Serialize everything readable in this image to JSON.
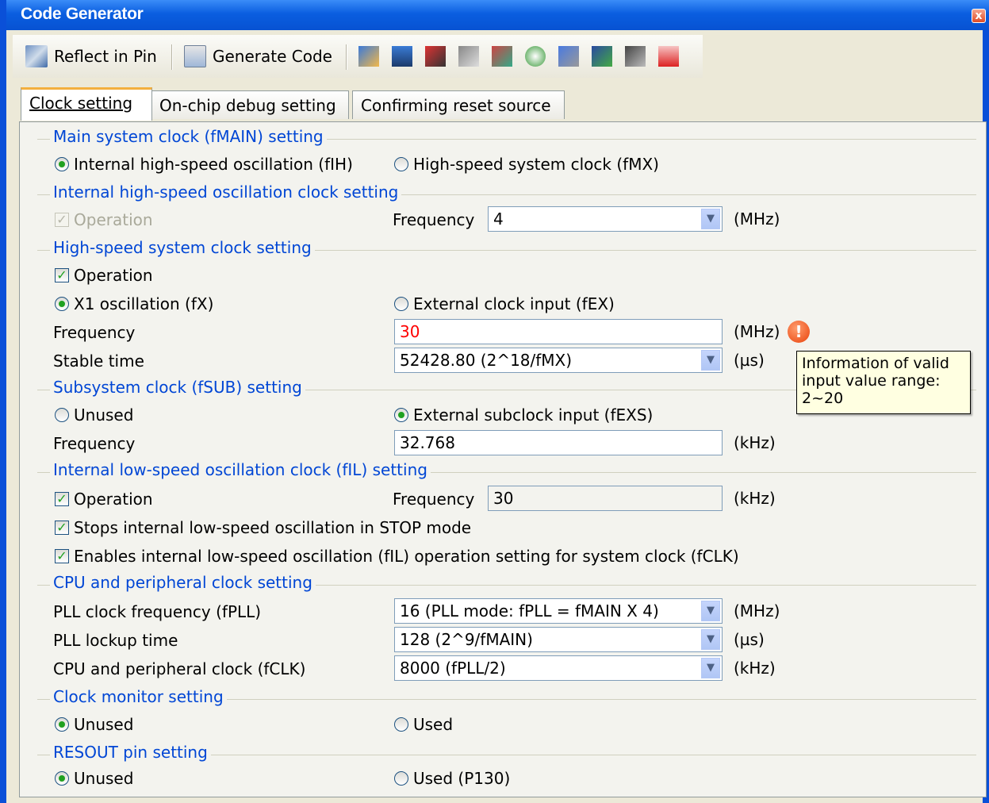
{
  "window": {
    "title": "Code Generator",
    "close": "x"
  },
  "toolbar": {
    "reflect_label": "Reflect in Pin",
    "generate_label": "Generate Code"
  },
  "tabs": [
    {
      "label": "Clock setting"
    },
    {
      "label": "On-chip debug setting"
    },
    {
      "label": "Confirming reset source"
    }
  ],
  "main_clock": {
    "title": "Main system clock (fMAIN) setting",
    "opt_internal": "Internal high-speed oscillation (fIH)",
    "opt_highspeed": "High-speed system clock (fMX)"
  },
  "ihso": {
    "title": "Internal high-speed oscillation clock setting",
    "operation": "Operation",
    "freq_label": "Frequency",
    "freq_value": "4",
    "unit": "(MHz)"
  },
  "hssc": {
    "title": "High-speed system clock setting",
    "operation": "Operation",
    "opt_x1": "X1 oscillation (fX)",
    "opt_ext": "External clock input (fEX)",
    "freq_label": "Frequency",
    "freq_value": "30",
    "freq_unit": "(MHz)",
    "stable_label": "Stable time",
    "stable_value": "52428.80 (2^18/fMX)",
    "stable_unit": "(µs)"
  },
  "tooltip": {
    "line1": "Information of valid",
    "line2": "input value range:",
    "line3": "2~20"
  },
  "subsys": {
    "title": "Subsystem clock (fSUB) setting",
    "opt_unused": "Unused",
    "opt_ext": "External subclock input (fEXS)",
    "freq_label": "Frequency",
    "freq_value": "32.768",
    "unit": "(kHz)"
  },
  "ilso": {
    "title": "Internal low-speed oscillation clock (fIL) setting",
    "operation": "Operation",
    "freq_label": "Frequency",
    "freq_value": "30",
    "unit": "(kHz)",
    "stop_label": "Stops internal low-speed oscillation in STOP mode",
    "enable_label": "Enables internal low-speed oscillation (fIL) operation setting for system clock (fCLK)"
  },
  "cpu": {
    "title": "CPU and peripheral clock setting",
    "pll_freq_label": "PLL clock frequency (fPLL)",
    "pll_freq_value": "16 (PLL mode: fPLL = fMAIN X 4)",
    "pll_freq_unit": "(MHz)",
    "pll_lock_label": "PLL lockup time",
    "pll_lock_value": "128 (2^9/fMAIN)",
    "pll_lock_unit": "(µs)",
    "fclk_label": "CPU and peripheral clock (fCLK)",
    "fclk_value": "8000 (fPLL/2)",
    "fclk_unit": "(kHz)"
  },
  "clock_monitor": {
    "title": "Clock monitor setting",
    "opt_unused": "Unused",
    "opt_used": "Used"
  },
  "resout": {
    "title": "RESOUT pin setting",
    "opt_unused": "Unused",
    "opt_used": "Used (P130)"
  }
}
